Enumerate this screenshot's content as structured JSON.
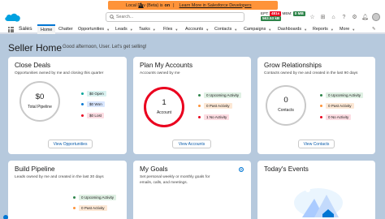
{
  "banner": {
    "prefix": "Local Dev (Beta) is",
    "status": "on",
    "link": "Learn More in Salesforce Developers"
  },
  "search": {
    "placeholder": "Search..."
  },
  "metrics": {
    "ept_label": "EPT:",
    "ept_value": "481s",
    "mem_label": "MEM:",
    "mem_value": "0 MB",
    "third_value": "563.53 kB"
  },
  "nav": {
    "app_name": "Sales",
    "tabs": [
      "Home",
      "Chatter",
      "Opportunities",
      "Leads",
      "Tasks",
      "Files",
      "Accounts",
      "Contacts",
      "Campaigns",
      "Dashboards",
      "Reports",
      "More"
    ]
  },
  "page": {
    "title": "Seller Home",
    "greeting": "Good afternoon, User. Let's get selling!"
  },
  "cards": {
    "close_deals": {
      "title": "Close Deals",
      "subtitle": "Opportunities owned by me and closing this quarter",
      "ring_value": "$0",
      "ring_label": "Total Pipeline",
      "legend": [
        "$0 Open",
        "$0 Won",
        "$0 Lost"
      ],
      "button": "View Opportunities"
    },
    "plan_accounts": {
      "title": "Plan My Accounts",
      "subtitle": "Accounts owned by me",
      "ring_value": "1",
      "ring_label": "Account",
      "legend": [
        "0 Upcoming Activity",
        "0 Past Activity",
        "1 No Activity"
      ],
      "button": "View Accounts"
    },
    "grow_relationships": {
      "title": "Grow Relationships",
      "subtitle": "Contacts owned by me and created in the last 90 days",
      "ring_value": "0",
      "ring_label": "Contacts",
      "legend": [
        "0 Upcoming Activity",
        "0 Past Activity",
        "0 No Activity"
      ],
      "button": "View Contacts"
    },
    "build_pipeline": {
      "title": "Build Pipeline",
      "subtitle": "Leads owned by me and created in the last 30 days",
      "legend": [
        "0 Upcoming Activity",
        "0 Past Activity"
      ]
    },
    "my_goals": {
      "title": "My Goals",
      "subtitle": "Set personal weekly or monthly goals for emails, calls, and meetings."
    },
    "events": {
      "title": "Today's Events"
    }
  },
  "colors": {
    "accent": "#0176d3",
    "green": "#2e844a",
    "orange": "#fe9339",
    "red": "#ea001e",
    "teal": "#06a59a"
  },
  "icons": [
    "salesforce-cloud-logo",
    "search-icon",
    "warning-icon",
    "star-icon",
    "add-icon",
    "setup-icon",
    "help-icon",
    "settings-gear-icon",
    "bell-icon",
    "app-launcher-icon",
    "chevron-down-icon"
  ]
}
